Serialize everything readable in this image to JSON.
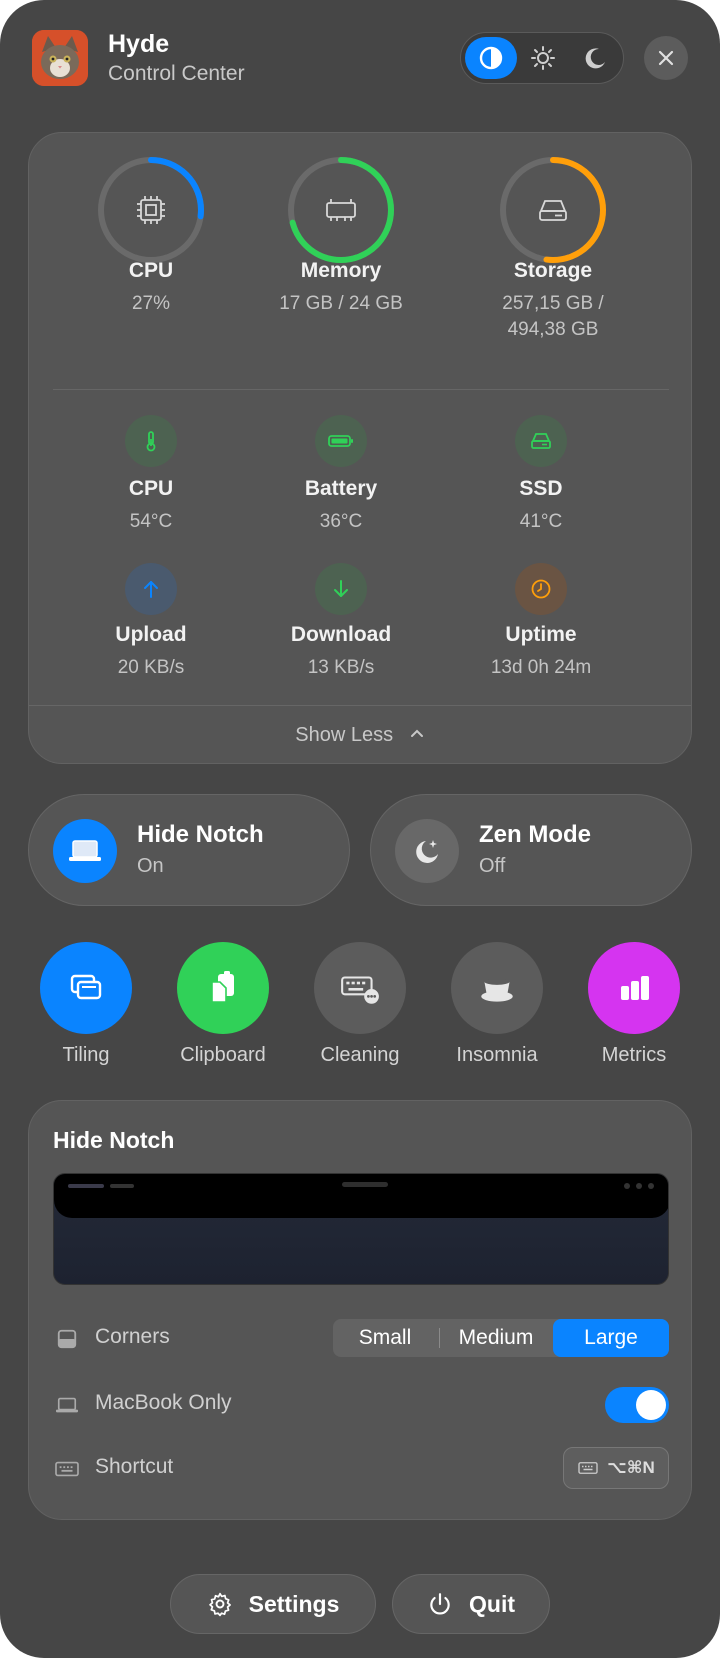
{
  "app": {
    "title": "Hyde",
    "subtitle": "Control Center"
  },
  "theme_modes": [
    {
      "icon": "contrast-icon",
      "active": true
    },
    {
      "icon": "sun-icon",
      "active": false
    },
    {
      "icon": "moon-icon",
      "active": false
    }
  ],
  "stats": {
    "rings": [
      {
        "title": "CPU",
        "value": "27%",
        "fraction": 0.27,
        "color": "#0a84ff",
        "icon": "cpu-chip-icon"
      },
      {
        "title": "Memory",
        "value": "17 GB / 24 GB",
        "fraction": 0.708,
        "color": "#30d158",
        "icon": "memory-icon"
      },
      {
        "title": "Storage",
        "value_line1": "257,15 GB /",
        "value_line2": "494,38 GB",
        "fraction": 0.52,
        "color": "#ff9f0a",
        "icon": "drive-icon"
      }
    ],
    "temps": [
      {
        "title": "CPU",
        "value": "54°C",
        "icon": "thermometer-icon"
      },
      {
        "title": "Battery",
        "value": "36°C",
        "icon": "battery-icon"
      },
      {
        "title": "SSD",
        "value": "41°C",
        "icon": "ssd-icon"
      }
    ],
    "network": [
      {
        "title": "Upload",
        "value": "20 KB/s",
        "icon": "arrow-up-icon"
      },
      {
        "title": "Download",
        "value": "13 KB/s",
        "icon": "arrow-down-icon"
      },
      {
        "title": "Uptime",
        "value": "13d 0h 24m",
        "icon": "clock-icon"
      }
    ],
    "toggle_label": "Show Less"
  },
  "pills": {
    "hide_notch": {
      "title": "Hide Notch",
      "state": "On"
    },
    "zen_mode": {
      "title": "Zen Mode",
      "state": "Off"
    }
  },
  "tools": [
    {
      "label": "Tiling",
      "color": "#0a84ff",
      "icon": "windows-icon"
    },
    {
      "label": "Clipboard",
      "color": "#30d158",
      "icon": "clipboard-icon"
    },
    {
      "label": "Cleaning",
      "color": "#5c5c5c",
      "icon": "keyboard-cleaning-icon"
    },
    {
      "label": "Insomnia",
      "color": "#5c5c5c",
      "icon": "coffee-cup-icon"
    },
    {
      "label": "Metrics",
      "color": "#d534f0",
      "icon": "bar-chart-icon"
    }
  ],
  "notch_settings": {
    "title": "Hide Notch",
    "corners_label": "Corners",
    "corner_options": [
      "Small",
      "Medium",
      "Large"
    ],
    "corner_selected": "Large",
    "macbook_only_label": "MacBook Only",
    "macbook_only_enabled": true,
    "shortcut_label": "Shortcut",
    "shortcut_keys": "⌥⌘N"
  },
  "footer": {
    "settings_label": "Settings",
    "quit_label": "Quit"
  }
}
